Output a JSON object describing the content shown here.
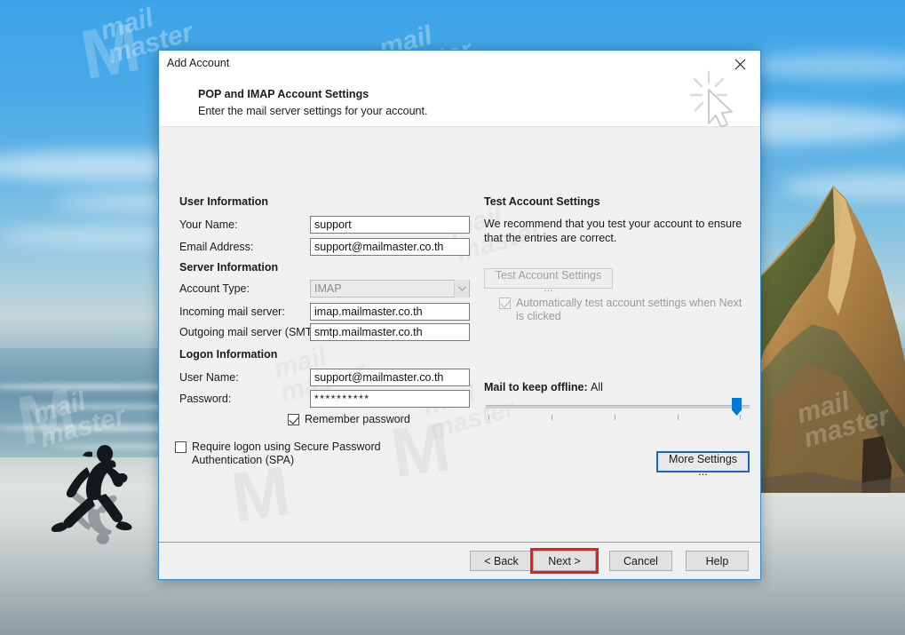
{
  "window": {
    "title": "Add Account",
    "close_icon": "close-icon",
    "decorative_icon": "click-cursor-icon"
  },
  "header": {
    "title": "POP and IMAP Account Settings",
    "subtitle": "Enter the mail server settings for your account."
  },
  "sections": {
    "user_information": {
      "heading": "User Information",
      "fields": [
        {
          "label": "Your Name:",
          "value": "support",
          "name": "your-name"
        },
        {
          "label": "Email Address:",
          "value": "support@mailmaster.co.th",
          "name": "email-address"
        }
      ]
    },
    "server_information": {
      "heading": "Server Information",
      "account_type": {
        "label": "Account Type:",
        "value": "IMAP",
        "disabled": true
      },
      "fields": [
        {
          "label": "Incoming mail server:",
          "value": "imap.mailmaster.co.th",
          "name": "incoming-mail-server"
        },
        {
          "label": "Outgoing mail server (SMTP):",
          "value": "smtp.mailmaster.co.th",
          "name": "outgoing-mail-server"
        }
      ]
    },
    "logon_information": {
      "heading": "Logon Information",
      "fields": [
        {
          "label": "User Name:",
          "value": "support@mailmaster.co.th",
          "name": "user-name"
        },
        {
          "label": "Password:",
          "value": "**********",
          "name": "password"
        }
      ],
      "remember_password": {
        "label": "Remember password",
        "checked": true
      },
      "require_spa": {
        "label": "Require logon using Secure Password Authentication (SPA)",
        "checked": false
      }
    },
    "test_account": {
      "heading": "Test Account Settings",
      "description": "We recommend that you test your account to ensure that the entries are correct.",
      "button_label": "Test Account Settings ...",
      "button_disabled": true,
      "auto_test": {
        "label": "Automatically test account settings when Next is clicked",
        "checked": true,
        "disabled": true
      }
    },
    "offline": {
      "label": "Mail to keep offline:",
      "value": "All",
      "slider_position_percent": 100,
      "tick_count": 5
    },
    "more_settings_label": "More Settings ..."
  },
  "footer": {
    "buttons": [
      {
        "label": "< Back",
        "name": "back-button",
        "highlighted": false
      },
      {
        "label": "Next >",
        "name": "next-button",
        "highlighted": true
      },
      {
        "label": "Cancel",
        "name": "cancel-button",
        "highlighted": false
      },
      {
        "label": "Help",
        "name": "help-button",
        "highlighted": false
      }
    ],
    "highlight_color": "#ee1c1c"
  },
  "colors": {
    "dialog_border": "#2f8fd8",
    "body_bg": "#f0f0f0",
    "accent": "#0078d7",
    "highlight": "#ee1c1c"
  },
  "watermark": {
    "text": "mail\nmaster"
  }
}
